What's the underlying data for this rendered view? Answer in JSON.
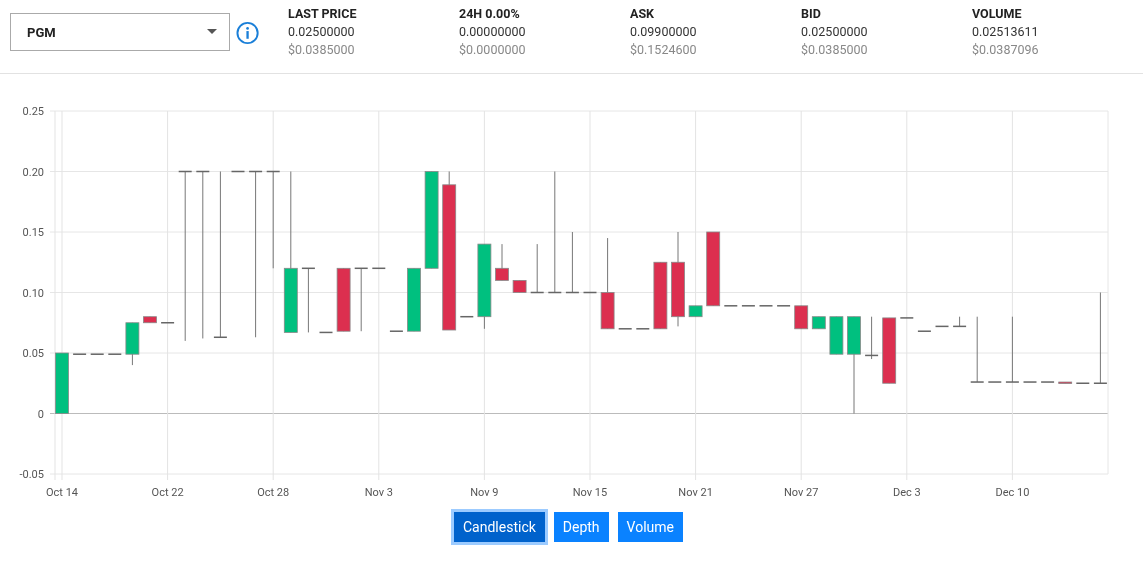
{
  "market_select": {
    "value": "PGM"
  },
  "stats": [
    {
      "label": "LAST PRICE",
      "value": "0.02500000",
      "usd": "$0.0385000"
    },
    {
      "label": "24H 0.00%",
      "value": "0.00000000",
      "usd": "$0.0000000"
    },
    {
      "label": "ASK",
      "value": "0.09900000",
      "usd": "$0.1524600"
    },
    {
      "label": "BID",
      "value": "0.02500000",
      "usd": "$0.0385000"
    },
    {
      "label": "VOLUME",
      "value": "0.02513611",
      "usd": "$0.0387096"
    }
  ],
  "chart_data": {
    "type": "candlestick",
    "grid": true,
    "categories": [
      "Oct 14",
      null,
      null,
      null,
      null,
      null,
      "Oct 22",
      null,
      null,
      null,
      null,
      null,
      "Oct 28",
      null,
      null,
      null,
      null,
      null,
      "Nov 3",
      null,
      null,
      null,
      null,
      null,
      "Nov 9",
      null,
      null,
      null,
      null,
      null,
      "Nov 15",
      null,
      null,
      null,
      null,
      null,
      "Nov 21",
      null,
      null,
      null,
      null,
      null,
      "Nov 27",
      null,
      null,
      null,
      null,
      null,
      "Dec 3",
      null,
      null,
      null,
      null,
      null,
      "Dec 10",
      null,
      null,
      null,
      null,
      null
    ],
    "ylim": [
      -0.05,
      0.25
    ],
    "yticks": [
      -0.05,
      0,
      0.05,
      {
        "value": 0.1,
        "label": "0.10"
      },
      0.15,
      {
        "value": 0.2,
        "label": "0.20"
      },
      0.25
    ],
    "ohlc": [
      [
        0,
        0.05,
        0,
        0.05
      ],
      [
        0.049,
        0.049,
        0.049,
        0.049
      ],
      [
        0.049,
        0.049,
        0.049,
        0.049
      ],
      [
        0.049,
        0.049,
        0.049,
        0.049
      ],
      [
        0.049,
        0.075,
        0.04,
        0.075
      ],
      [
        0.08,
        0.08,
        0.075,
        0.075
      ],
      [
        0.075,
        0.075,
        0.075,
        0.075
      ],
      [
        0.2,
        0.2,
        0.06,
        0.2
      ],
      [
        0.2,
        0.2,
        0.062,
        0.2
      ],
      [
        0.063,
        0.2,
        0.063,
        0.063
      ],
      [
        0.2,
        0.2,
        0.2,
        0.2
      ],
      [
        0.2,
        0.2,
        0.063,
        0.2
      ],
      [
        0.2,
        0.2,
        0.12,
        0.2
      ],
      [
        0.067,
        0.2,
        0.067,
        0.12
      ],
      [
        0.12,
        0.12,
        0.067,
        0.12
      ],
      [
        0.067,
        0.067,
        0.067,
        0.067
      ],
      [
        0.12,
        0.12,
        0.068,
        0.068
      ],
      [
        0.12,
        0.12,
        0.068,
        0.12
      ],
      [
        0.12,
        0.12,
        0.12,
        0.12
      ],
      [
        0.068,
        0.068,
        0.068,
        0.068
      ],
      [
        0.068,
        0.12,
        0.068,
        0.12
      ],
      [
        0.12,
        0.2,
        0.12,
        0.2
      ],
      [
        0.189,
        0.2,
        0.069,
        0.069
      ],
      [
        0.08,
        0.08,
        0.08,
        0.08
      ],
      [
        0.08,
        0.14,
        0.07,
        0.14
      ],
      [
        0.12,
        0.14,
        0.11,
        0.11
      ],
      [
        0.11,
        0.11,
        0.1,
        0.1
      ],
      [
        0.1,
        0.14,
        0.1,
        0.1
      ],
      [
        0.1,
        0.2,
        0.1,
        0.1
      ],
      [
        0.1,
        0.15,
        0.1,
        0.1
      ],
      [
        0.1,
        0.1,
        0.1,
        0.1
      ],
      [
        0.1,
        0.145,
        0.07,
        0.07
      ],
      [
        0.07,
        0.07,
        0.07,
        0.07
      ],
      [
        0.07,
        0.07,
        0.07,
        0.07
      ],
      [
        0.125,
        0.125,
        0.07,
        0.07
      ],
      [
        0.125,
        0.15,
        0.072,
        0.08
      ],
      [
        0.08,
        0.089,
        0.08,
        0.089
      ],
      [
        0.15,
        0.15,
        0.089,
        0.089
      ],
      [
        0.089,
        0.089,
        0.089,
        0.089
      ],
      [
        0.089,
        0.089,
        0.089,
        0.089
      ],
      [
        0.089,
        0.089,
        0.089,
        0.089
      ],
      [
        0.089,
        0.089,
        0.089,
        0.089
      ],
      [
        0.089,
        0.089,
        0.07,
        0.07
      ],
      [
        0.07,
        0.08,
        0.07,
        0.08
      ],
      [
        0.049,
        0.08,
        0.049,
        0.08
      ],
      [
        0.049,
        0.08,
        0,
        0.08
      ],
      [
        0.048,
        0.08,
        0.045,
        0.048
      ],
      [
        0.079,
        0.079,
        0.025,
        0.025
      ],
      [
        0.079,
        0.079,
        0.079,
        0.079
      ],
      [
        0.068,
        0.068,
        0.068,
        0.068
      ],
      [
        0.072,
        0.072,
        0.072,
        0.072
      ],
      [
        0.072,
        0.08,
        0.072,
        0.072
      ],
      [
        0.026,
        0.08,
        0.026,
        0.026
      ],
      [
        0.026,
        0.026,
        0.026,
        0.026
      ],
      [
        0.026,
        0.08,
        0.026,
        0.026
      ],
      [
        0.026,
        0.026,
        0.026,
        0.026
      ],
      [
        0.026,
        0.026,
        0.026,
        0.026
      ],
      [
        0.026,
        0.026,
        0.025,
        0.025
      ],
      [
        0.025,
        0.025,
        0.025,
        0.025
      ],
      [
        0.025,
        0.1,
        0.025,
        0.025
      ]
    ]
  },
  "chart_buttons": [
    {
      "label": "Candlestick",
      "selected": true
    },
    {
      "label": "Depth",
      "selected": false
    },
    {
      "label": "Volume",
      "selected": false
    }
  ]
}
